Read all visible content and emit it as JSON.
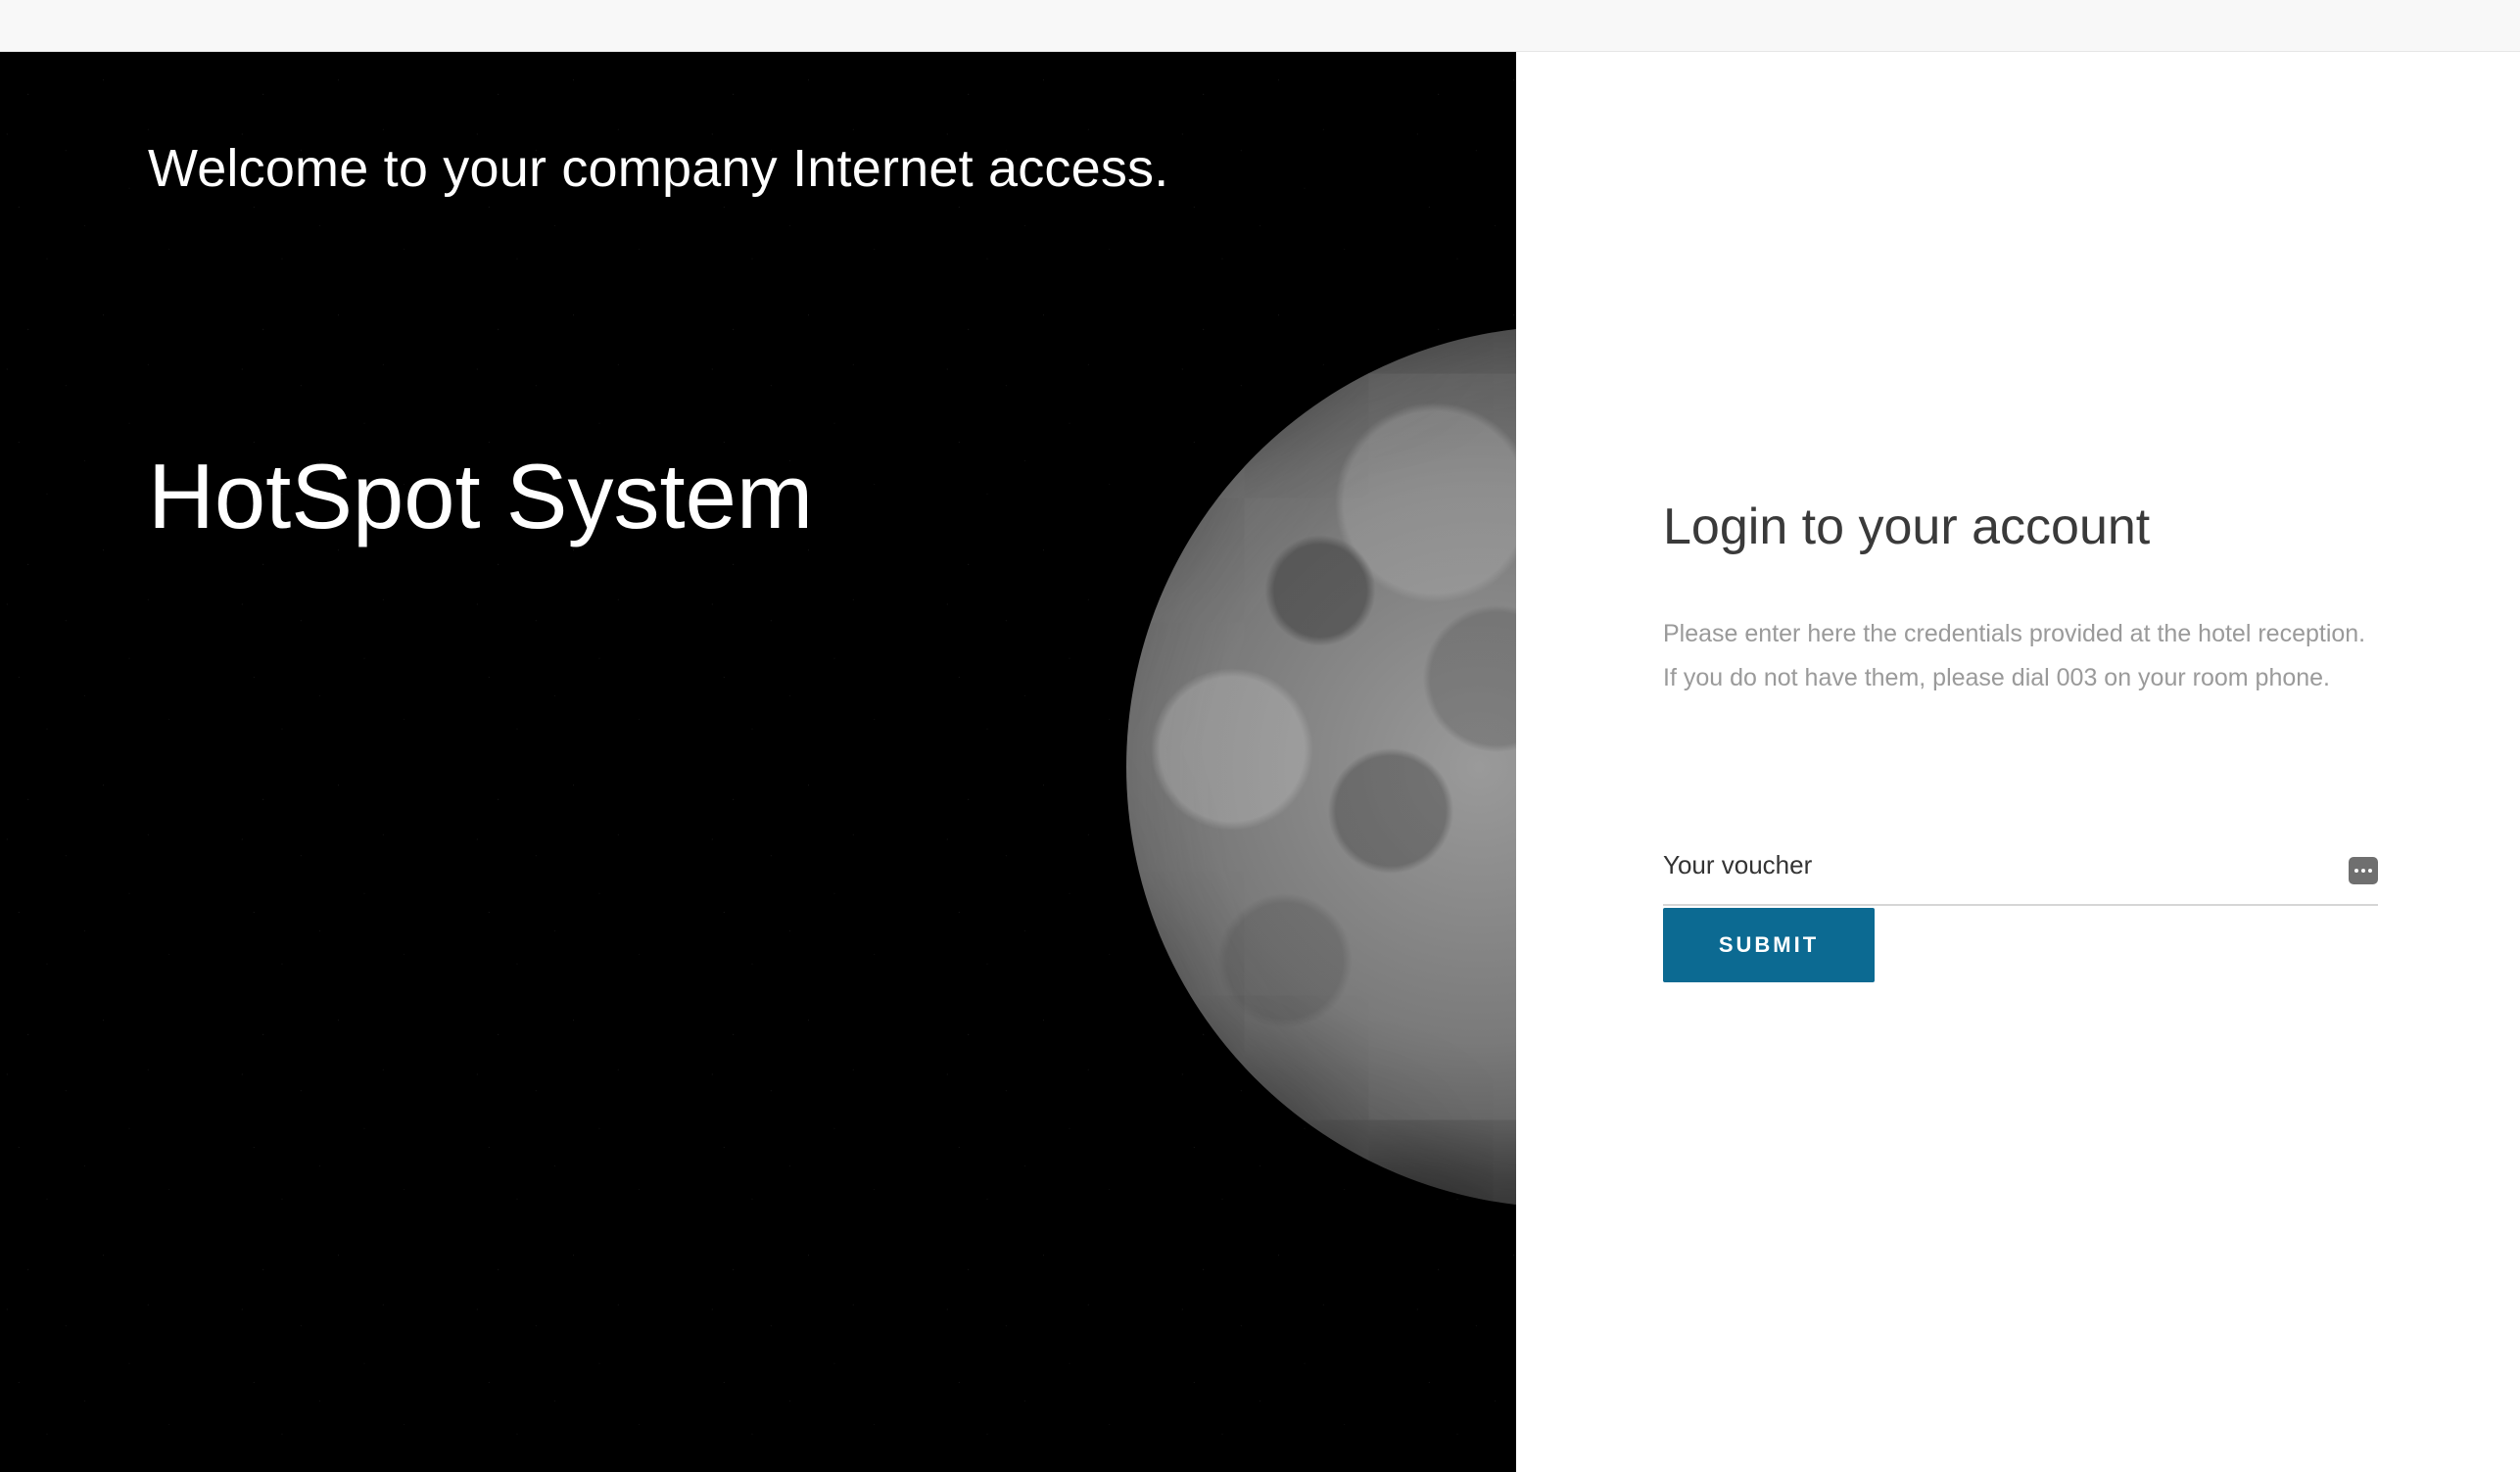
{
  "hero": {
    "welcome": "Welcome to your company Internet access.",
    "brand": "HotSpot System"
  },
  "login": {
    "title": "Login to your account",
    "instructions_line1": "Please enter here the credentials provided at the hotel reception.",
    "instructions_line2": "If you do not have them, please dial 003 on your room phone.",
    "voucher_placeholder": "Your voucher",
    "voucher_value": "",
    "submit_label": "SUBMIT"
  },
  "colors": {
    "accent": "#0c6a92",
    "hero_background": "#000000",
    "muted_text": "#9a9a9a"
  },
  "icons": {
    "voucher_field_icon": "more-dots-icon"
  }
}
